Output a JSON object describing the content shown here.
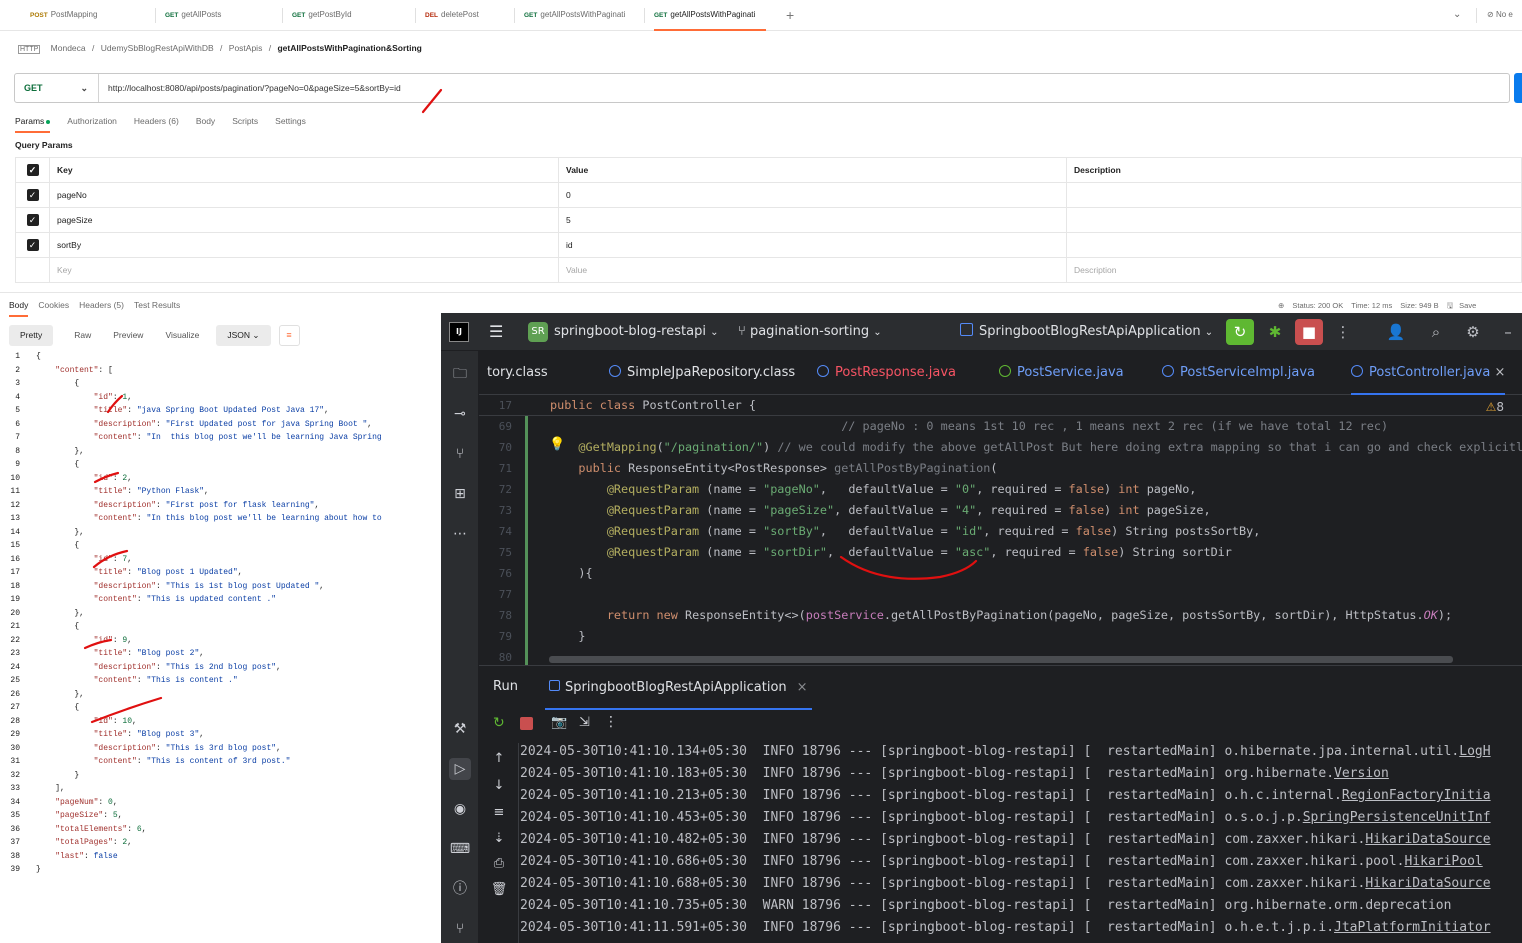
{
  "postman": {
    "tabs": [
      {
        "method": "POST",
        "name": "PostMapping",
        "color": "#ad7a03"
      },
      {
        "method": "GET",
        "name": "getAllPosts",
        "color": "#0d6e3b"
      },
      {
        "method": "GET",
        "name": "getPostById",
        "color": "#0d6e3b"
      },
      {
        "method": "DEL",
        "name": "deletePost",
        "color": "#b5290a"
      },
      {
        "method": "GET",
        "name": "getAllPostsWithPaginati",
        "color": "#0d6e3b"
      },
      {
        "method": "GET",
        "name": "getAllPostsWithPaginati",
        "color": "#0d6e3b"
      }
    ],
    "add_tab": "+",
    "env": "No e",
    "breadcrumb": {
      "parts": [
        "Mondeca",
        "UdemySbBlogRestApiWithDB",
        "PostApis"
      ],
      "current": "getAllPostsWithPagination&Sorting",
      "sep": "/"
    },
    "method": "GET",
    "url": "http://localhost:8080/api/posts/pagination/?pageNo=0&pageSize=5&sortBy=id",
    "request_tabs": [
      "Params",
      "Authorization",
      "Headers (6)",
      "Body",
      "Scripts",
      "Settings"
    ],
    "query_params_title": "Query Params",
    "columns": [
      "Key",
      "Value",
      "Description"
    ],
    "params": [
      {
        "key": "pageNo",
        "value": "0",
        "description": ""
      },
      {
        "key": "pageSize",
        "value": "5",
        "description": ""
      },
      {
        "key": "sortBy",
        "value": "id",
        "description": ""
      }
    ],
    "placeholder": {
      "key": "Key",
      "value": "Value",
      "description": "Description"
    },
    "response_tabs": [
      "Body",
      "Cookies",
      "Headers (5)",
      "Test Results"
    ],
    "status": {
      "status": "Status: 200 OK",
      "time": "Time: 12 ms",
      "size": "Size: 949 B",
      "save": "Save"
    },
    "format_tabs": [
      "Pretty",
      "Raw",
      "Preview",
      "Visualize"
    ],
    "format": "JSON",
    "json_lines": [
      [
        [
          "p",
          "{"
        ]
      ],
      [
        [
          "p",
          "    "
        ],
        [
          "k",
          "\"content\""
        ],
        [
          "p",
          ": ["
        ]
      ],
      [
        [
          "p",
          "        {"
        ]
      ],
      [
        [
          "p",
          "            "
        ],
        [
          "k",
          "\"id\""
        ],
        [
          "p",
          ": "
        ],
        [
          "n",
          "1"
        ],
        [
          "p",
          ","
        ]
      ],
      [
        [
          "p",
          "            "
        ],
        [
          "k",
          "\"title\""
        ],
        [
          "p",
          ": "
        ],
        [
          "s",
          "\"java Spring Boot Updated Post Java 17\""
        ],
        [
          "p",
          ","
        ]
      ],
      [
        [
          "p",
          "            "
        ],
        [
          "k",
          "\"description\""
        ],
        [
          "p",
          ": "
        ],
        [
          "s",
          "\"First Updated post for java Spring Boot \""
        ],
        [
          "p",
          ","
        ]
      ],
      [
        [
          "p",
          "            "
        ],
        [
          "k",
          "\"content\""
        ],
        [
          "p",
          ": "
        ],
        [
          "s",
          "\"In  this blog post we'll be learning Java Spring"
        ]
      ],
      [
        [
          "p",
          "        },"
        ]
      ],
      [
        [
          "p",
          "        {"
        ]
      ],
      [
        [
          "p",
          "            "
        ],
        [
          "k",
          "\"id\""
        ],
        [
          "p",
          ": "
        ],
        [
          "n",
          "2"
        ],
        [
          "p",
          ","
        ]
      ],
      [
        [
          "p",
          "            "
        ],
        [
          "k",
          "\"title\""
        ],
        [
          "p",
          ": "
        ],
        [
          "s",
          "\"Python Flask\""
        ],
        [
          "p",
          ","
        ]
      ],
      [
        [
          "p",
          "            "
        ],
        [
          "k",
          "\"description\""
        ],
        [
          "p",
          ": "
        ],
        [
          "s",
          "\"First post for flask learning\""
        ],
        [
          "p",
          ","
        ]
      ],
      [
        [
          "p",
          "            "
        ],
        [
          "k",
          "\"content\""
        ],
        [
          "p",
          ": "
        ],
        [
          "s",
          "\"In this blog post we'll be learning about how to"
        ]
      ],
      [
        [
          "p",
          "        },"
        ]
      ],
      [
        [
          "p",
          "        {"
        ]
      ],
      [
        [
          "p",
          "            "
        ],
        [
          "k",
          "\"id\""
        ],
        [
          "p",
          ": "
        ],
        [
          "n",
          "7"
        ],
        [
          "p",
          ","
        ]
      ],
      [
        [
          "p",
          "            "
        ],
        [
          "k",
          "\"title\""
        ],
        [
          "p",
          ": "
        ],
        [
          "s",
          "\"Blog post 1 Updated\""
        ],
        [
          "p",
          ","
        ]
      ],
      [
        [
          "p",
          "            "
        ],
        [
          "k",
          "\"description\""
        ],
        [
          "p",
          ": "
        ],
        [
          "s",
          "\"This is 1st blog post Updated \""
        ],
        [
          "p",
          ","
        ]
      ],
      [
        [
          "p",
          "            "
        ],
        [
          "k",
          "\"content\""
        ],
        [
          "p",
          ": "
        ],
        [
          "s",
          "\"This is updated content .\""
        ]
      ],
      [
        [
          "p",
          "        },"
        ]
      ],
      [
        [
          "p",
          "        {"
        ]
      ],
      [
        [
          "p",
          "            "
        ],
        [
          "k",
          "\"id\""
        ],
        [
          "p",
          ": "
        ],
        [
          "n",
          "9"
        ],
        [
          "p",
          ","
        ]
      ],
      [
        [
          "p",
          "            "
        ],
        [
          "k",
          "\"title\""
        ],
        [
          "p",
          ": "
        ],
        [
          "s",
          "\"Blog post 2\""
        ],
        [
          "p",
          ","
        ]
      ],
      [
        [
          "p",
          "            "
        ],
        [
          "k",
          "\"description\""
        ],
        [
          "p",
          ": "
        ],
        [
          "s",
          "\"This is 2nd blog post\""
        ],
        [
          "p",
          ","
        ]
      ],
      [
        [
          "p",
          "            "
        ],
        [
          "k",
          "\"content\""
        ],
        [
          "p",
          ": "
        ],
        [
          "s",
          "\"This is content .\""
        ]
      ],
      [
        [
          "p",
          "        },"
        ]
      ],
      [
        [
          "p",
          "        {"
        ]
      ],
      [
        [
          "p",
          "            "
        ],
        [
          "k",
          "\"id\""
        ],
        [
          "p",
          ": "
        ],
        [
          "n",
          "10"
        ],
        [
          "p",
          ","
        ]
      ],
      [
        [
          "p",
          "            "
        ],
        [
          "k",
          "\"title\""
        ],
        [
          "p",
          ": "
        ],
        [
          "s",
          "\"Blog post 3\""
        ],
        [
          "p",
          ","
        ]
      ],
      [
        [
          "p",
          "            "
        ],
        [
          "k",
          "\"description\""
        ],
        [
          "p",
          ": "
        ],
        [
          "s",
          "\"This is 3rd blog post\""
        ],
        [
          "p",
          ","
        ]
      ],
      [
        [
          "p",
          "            "
        ],
        [
          "k",
          "\"content\""
        ],
        [
          "p",
          ": "
        ],
        [
          "s",
          "\"This is content of 3rd post.\""
        ]
      ],
      [
        [
          "p",
          "        }"
        ]
      ],
      [
        [
          "p",
          "    ],"
        ]
      ],
      [
        [
          "p",
          "    "
        ],
        [
          "k",
          "\"pageNum\""
        ],
        [
          "p",
          ": "
        ],
        [
          "n",
          "0"
        ],
        [
          "p",
          ","
        ]
      ],
      [
        [
          "p",
          "    "
        ],
        [
          "k",
          "\"pageSize\""
        ],
        [
          "p",
          ": "
        ],
        [
          "n",
          "5"
        ],
        [
          "p",
          ","
        ]
      ],
      [
        [
          "p",
          "    "
        ],
        [
          "k",
          "\"totalElements\""
        ],
        [
          "p",
          ": "
        ],
        [
          "n",
          "6"
        ],
        [
          "p",
          ","
        ]
      ],
      [
        [
          "p",
          "    "
        ],
        [
          "k",
          "\"totalPages\""
        ],
        [
          "p",
          ": "
        ],
        [
          "n",
          "2"
        ],
        [
          "p",
          ","
        ]
      ],
      [
        [
          "p",
          "    "
        ],
        [
          "k",
          "\"last\""
        ],
        [
          "p",
          ": "
        ],
        [
          "kw",
          "false"
        ]
      ],
      [
        [
          "p",
          "}"
        ]
      ]
    ]
  },
  "ide": {
    "logo": "IJ",
    "project_badge": "SR",
    "project": "springboot-blog-restapi",
    "branch": "pagination-sorting",
    "run_config": "SpringbootBlogRestApiApplication",
    "editor_tabs": [
      {
        "name": "tory.class",
        "icon": ""
      },
      {
        "name": "SimpleJpaRepository.class",
        "icon": "c"
      },
      {
        "name": "PostResponse.java",
        "icon": "c"
      },
      {
        "name": "PostService.java",
        "icon": "i"
      },
      {
        "name": "PostServiceImpl.java",
        "icon": "c"
      },
      {
        "name": "PostController.java",
        "icon": "c"
      }
    ],
    "warnings": "8",
    "sticky_line": {
      "num": "17",
      "code": [
        [
          "jk",
          "public class "
        ],
        [
          "p",
          "PostController {"
        ]
      ]
    },
    "code_lines": [
      {
        "num": "69",
        "code": [
          [
            "cm",
            "                                         // pageNo : 0 means 1st 10 rec , 1 means next 2 rec (if we have total 12 rec)"
          ]
        ]
      },
      {
        "num": "70",
        "code": [
          [
            "p",
            "    "
          ],
          [
            "ann",
            "@GetMapping"
          ],
          [
            "p",
            "("
          ],
          [
            "str",
            "\"/pagination/\""
          ],
          [
            "p",
            ") "
          ],
          [
            "cm",
            "// we could modify the above getAllPost But here doing extra mapping so that i can go and check explicitly"
          ]
        ]
      },
      {
        "num": "71",
        "code": [
          [
            "p",
            "    "
          ],
          [
            "jk",
            "public "
          ],
          [
            "p",
            "ResponseEntity<PostResponse> "
          ],
          [
            "fn2",
            "getAllPostByPagination"
          ],
          [
            "p",
            "("
          ]
        ]
      },
      {
        "num": "72",
        "code": [
          [
            "p",
            "        "
          ],
          [
            "ann",
            "@RequestParam"
          ],
          [
            "p",
            " (name = "
          ],
          [
            "str",
            "\"pageNo\""
          ],
          [
            "p",
            ",   defaultValue = "
          ],
          [
            "str",
            "\"0\""
          ],
          [
            "p",
            ", required = "
          ],
          [
            "jk",
            "false"
          ],
          [
            "p",
            ") "
          ],
          [
            "jk",
            "int "
          ],
          [
            "p",
            "pageNo,"
          ]
        ]
      },
      {
        "num": "73",
        "code": [
          [
            "p",
            "        "
          ],
          [
            "ann",
            "@RequestParam"
          ],
          [
            "p",
            " (name = "
          ],
          [
            "str",
            "\"pageSize\""
          ],
          [
            "p",
            ", defaultValue = "
          ],
          [
            "str",
            "\"4\""
          ],
          [
            "p",
            ", required = "
          ],
          [
            "jk",
            "false"
          ],
          [
            "p",
            ") "
          ],
          [
            "jk",
            "int "
          ],
          [
            "p",
            "pageSize,"
          ]
        ]
      },
      {
        "num": "74",
        "code": [
          [
            "p",
            "        "
          ],
          [
            "ann",
            "@RequestParam"
          ],
          [
            "p",
            " (name = "
          ],
          [
            "str",
            "\"sortBy\""
          ],
          [
            "p",
            ",   defaultValue = "
          ],
          [
            "str",
            "\"id\""
          ],
          [
            "p",
            ", required = "
          ],
          [
            "jk",
            "false"
          ],
          [
            "p",
            ") String postsSortBy,"
          ]
        ]
      },
      {
        "num": "75",
        "code": [
          [
            "p",
            "        "
          ],
          [
            "ann",
            "@RequestParam"
          ],
          [
            "p",
            " (name = "
          ],
          [
            "str",
            "\"sortDir\""
          ],
          [
            "p",
            ",  defaultValue = "
          ],
          [
            "str",
            "\"asc\""
          ],
          [
            "p",
            ", required = "
          ],
          [
            "jk",
            "false"
          ],
          [
            "p",
            ") String sortDir"
          ]
        ]
      },
      {
        "num": "76",
        "code": [
          [
            "p",
            "    ){"
          ]
        ]
      },
      {
        "num": "77",
        "code": [
          [
            "p",
            ""
          ]
        ]
      },
      {
        "num": "78",
        "code": [
          [
            "p",
            "        "
          ],
          [
            "jk",
            "return new "
          ],
          [
            "p",
            "ResponseEntity<>("
          ],
          [
            "pm",
            "postService"
          ],
          [
            "p",
            ".getAllPostByPagination(pageNo, pageSize, postsSortBy, sortDir), HttpStatus."
          ],
          [
            "it",
            "OK"
          ],
          [
            "p",
            ");"
          ]
        ]
      },
      {
        "num": "79",
        "code": [
          [
            "p",
            "    }"
          ]
        ]
      },
      {
        "num": "80",
        "code": [
          [
            "p",
            ""
          ]
        ]
      }
    ],
    "run_label": "Run",
    "run_tab": "SpringbootBlogRestApiApplication",
    "log_lines": [
      {
        "ts": "2024-05-30T10:41:10.134+05:30",
        "lvl": "INFO",
        "pid": "18796",
        "app": "[springboot-blog-restapi]",
        "thread": "[  restartedMain]",
        "logger": "o.hibernate.jpa.internal.util.",
        "u": "LogH"
      },
      {
        "ts": "2024-05-30T10:41:10.183+05:30",
        "lvl": "INFO",
        "pid": "18796",
        "app": "[springboot-blog-restapi]",
        "thread": "[  restartedMain]",
        "logger": "org.hibernate.",
        "u": "Version"
      },
      {
        "ts": "2024-05-30T10:41:10.213+05:30",
        "lvl": "INFO",
        "pid": "18796",
        "app": "[springboot-blog-restapi]",
        "thread": "[  restartedMain]",
        "logger": "o.h.c.internal.",
        "u": "RegionFactoryInitia"
      },
      {
        "ts": "2024-05-30T10:41:10.453+05:30",
        "lvl": "INFO",
        "pid": "18796",
        "app": "[springboot-blog-restapi]",
        "thread": "[  restartedMain]",
        "logger": "o.s.o.j.p.",
        "u": "SpringPersistenceUnitInf"
      },
      {
        "ts": "2024-05-30T10:41:10.482+05:30",
        "lvl": "INFO",
        "pid": "18796",
        "app": "[springboot-blog-restapi]",
        "thread": "[  restartedMain]",
        "logger": "com.zaxxer.hikari.",
        "u": "HikariDataSource"
      },
      {
        "ts": "2024-05-30T10:41:10.686+05:30",
        "lvl": "INFO",
        "pid": "18796",
        "app": "[springboot-blog-restapi]",
        "thread": "[  restartedMain]",
        "logger": "com.zaxxer.hikari.pool.",
        "u": "HikariPool"
      },
      {
        "ts": "2024-05-30T10:41:10.688+05:30",
        "lvl": "INFO",
        "pid": "18796",
        "app": "[springboot-blog-restapi]",
        "thread": "[  restartedMain]",
        "logger": "com.zaxxer.hikari.",
        "u": "HikariDataSource"
      },
      {
        "ts": "2024-05-30T10:41:10.735+05:30",
        "lvl": "WARN",
        "pid": "18796",
        "app": "[springboot-blog-restapi]",
        "thread": "[  restartedMain]",
        "logger": "org.hibernate.orm.deprecation",
        "u": ""
      },
      {
        "ts": "2024-05-30T10:41:11.591+05:30",
        "lvl": "INFO",
        "pid": "18796",
        "app": "[springboot-blog-restapi]",
        "thread": "[  restartedMain]",
        "logger": "o.h.e.t.j.p.i.",
        "u": "JtaPlatformInitiator"
      }
    ]
  },
  "colors": {
    "postman_accent": "#ff6c37",
    "ide_bg": "#1e1f22",
    "ide_panel": "#2b2d30",
    "run_green": "#5fb832",
    "stop_red": "#c94f4f",
    "annotation_red": "#e01010"
  }
}
